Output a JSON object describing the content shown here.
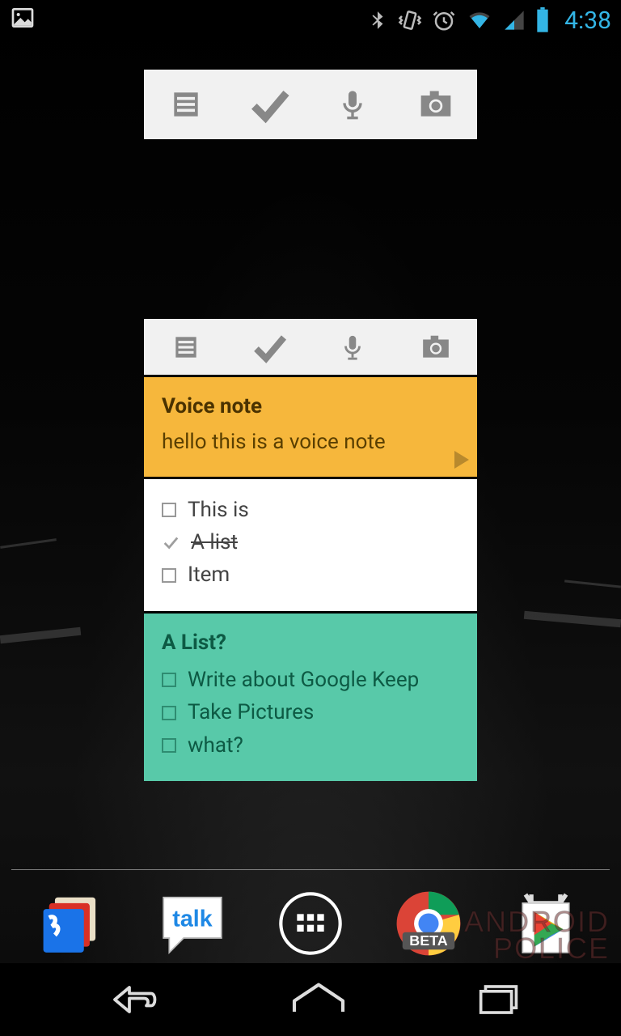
{
  "status": {
    "time": "4:38"
  },
  "toolbar": {
    "note_label": "Note",
    "list_label": "List",
    "voice_label": "Voice",
    "photo_label": "Photo"
  },
  "notes": [
    {
      "color": "orange",
      "title": "Voice note",
      "body": "hello this is a voice note",
      "has_play": true
    },
    {
      "color": "white",
      "items": [
        {
          "label": "This is",
          "done": false
        },
        {
          "label": "A list",
          "done": true
        },
        {
          "label": "Item",
          "done": false
        }
      ]
    },
    {
      "color": "teal",
      "title": "A List?",
      "items": [
        {
          "label": "Write about Google Keep",
          "done": false
        },
        {
          "label": "Take Pictures",
          "done": false
        },
        {
          "label": "what?",
          "done": false
        }
      ]
    }
  ],
  "dock": {
    "talk_label": "talk",
    "chrome_badge": "BETA"
  },
  "watermark": {
    "line1": "ANDROID",
    "line2": "POLICE"
  }
}
